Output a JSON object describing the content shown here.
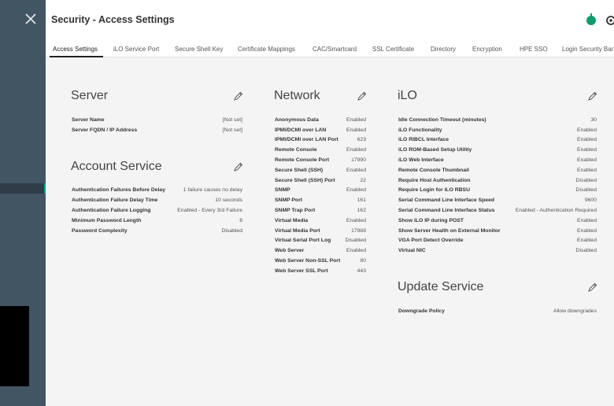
{
  "header": {
    "title": "Security - Access Settings",
    "status_icon": "health-status-icon",
    "accent_color": "#01a982"
  },
  "tabs": [
    {
      "label": "Access Settings",
      "active": true
    },
    {
      "label": "iLO Service Port"
    },
    {
      "label": "Secure Shell Key"
    },
    {
      "label": "Certificate Mappings"
    },
    {
      "label": "CAC/Smartcard"
    },
    {
      "label": "SSL Certificate"
    },
    {
      "label": "Directory"
    },
    {
      "label": "Encryption"
    },
    {
      "label": "HPE SSO"
    },
    {
      "label": "Login Security Banner"
    }
  ],
  "server": {
    "title": "Server",
    "rows": [
      {
        "label": "Server Name",
        "value": "[Not set]"
      },
      {
        "label": "Server FQDN / IP Address",
        "value": "[Not set]"
      }
    ]
  },
  "account_service": {
    "title": "Account Service",
    "rows": [
      {
        "label": "Authentication Failures Before Delay",
        "value": "1 failure causes no delay"
      },
      {
        "label": "Authentication Failure Delay Time",
        "value": "10 seconds"
      },
      {
        "label": "Authentication Failure Logging",
        "value": "Enabled - Every 3rd Failure"
      },
      {
        "label": "Minimum Password Length",
        "value": "8"
      },
      {
        "label": "Password Complexity",
        "value": "Disabled"
      }
    ]
  },
  "network": {
    "title": "Network",
    "rows": [
      {
        "label": "Anonymous Data",
        "value": "Enabled"
      },
      {
        "label": "IPMI/DCMI over LAN",
        "value": "Enabled"
      },
      {
        "label": "IPMI/DCMI over LAN Port",
        "value": "623"
      },
      {
        "label": "Remote Console",
        "value": "Enabled"
      },
      {
        "label": "Remote Console Port",
        "value": "17990"
      },
      {
        "label": "Secure Shell (SSH)",
        "value": "Enabled"
      },
      {
        "label": "Secure Shell (SSH) Port",
        "value": "22"
      },
      {
        "label": "SNMP",
        "value": "Enabled"
      },
      {
        "label": "SNMP Port",
        "value": "161"
      },
      {
        "label": "SNMP Trap Port",
        "value": "162"
      },
      {
        "label": "Virtual Media",
        "value": "Enabled"
      },
      {
        "label": "Virtual Media Port",
        "value": "17988"
      },
      {
        "label": "Virtual Serial Port Log",
        "value": "Disabled"
      },
      {
        "label": "Web Server",
        "value": "Enabled"
      },
      {
        "label": "Web Server Non-SSL Port",
        "value": "80"
      },
      {
        "label": "Web Server SSL Port",
        "value": "443"
      }
    ]
  },
  "ilo": {
    "title": "iLO",
    "rows": [
      {
        "label": "Idle Connection Timeout (minutes)",
        "value": "30"
      },
      {
        "label": "iLO Functionality",
        "value": "Enabled"
      },
      {
        "label": "iLO RIBCL Interface",
        "value": "Enabled"
      },
      {
        "label": "iLO ROM-Based Setup Utility",
        "value": "Enabled"
      },
      {
        "label": "iLO Web Interface",
        "value": "Enabled"
      },
      {
        "label": "Remote Console Thumbnail",
        "value": "Enabled"
      },
      {
        "label": "Require Host Authentication",
        "value": "Disabled"
      },
      {
        "label": "Require Login for iLO RBSU",
        "value": "Disabled"
      },
      {
        "label": "Serial Command Line Interface Speed",
        "value": "9600"
      },
      {
        "label": "Serial Command Line Interface Status",
        "value": "Enabled - Authentication Required"
      },
      {
        "label": "Show iLO IP during POST",
        "value": "Enabled"
      },
      {
        "label": "Show Server Health on External Monitor",
        "value": "Enabled"
      },
      {
        "label": "VGA Port Detect Override",
        "value": "Enabled"
      },
      {
        "label": "Virtual NIC",
        "value": "Disabled"
      }
    ]
  },
  "update_service": {
    "title": "Update Service",
    "rows": [
      {
        "label": "Downgrade Policy",
        "value": "Allow downgrades"
      }
    ]
  }
}
